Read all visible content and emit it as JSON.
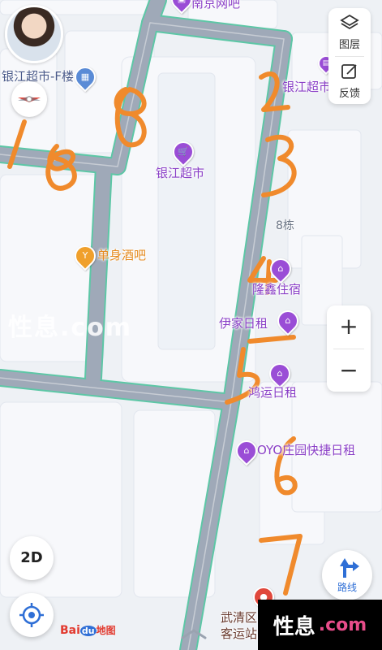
{
  "map": {
    "pois": [
      {
        "name": "南京网吧",
        "kind": "internet-cafe",
        "color": "#9a4dd6"
      },
      {
        "name": "银江超市-F楼",
        "kind": "building",
        "color": "#5a8bd6"
      },
      {
        "name": "银江超市",
        "kind": "supermarket",
        "color": "#9a4dd6"
      },
      {
        "name": "银江超市",
        "kind": "supermarket",
        "color": "#9a4dd6"
      },
      {
        "name": "8栋",
        "kind": "building-number"
      },
      {
        "name": "单身酒吧",
        "kind": "bar",
        "color": "#f0a02c"
      },
      {
        "name": "隆鑫住宿",
        "kind": "hotel",
        "color": "#9a4dd6"
      },
      {
        "name": "伊家日租",
        "kind": "hotel",
        "color": "#9a4dd6"
      },
      {
        "name": "鸿运日租",
        "kind": "hotel",
        "color": "#9a4dd6"
      },
      {
        "name": "OYO庄园快捷日租",
        "kind": "hotel",
        "color": "#9a4dd6"
      },
      {
        "name": "武清区客运站",
        "kind": "bus-station",
        "color": "#e0483c"
      }
    ],
    "handwritten_numbers": [
      "1",
      "8",
      "8",
      "2",
      "3",
      "4",
      "5",
      "6",
      "7"
    ],
    "ink_color": "#f08a2c"
  },
  "controls": {
    "layers_label": "图层",
    "feedback_label": "反馈",
    "zoom_in": "+",
    "zoom_out": "−",
    "mode_2d": "2D",
    "route_label": "路线"
  },
  "branding": {
    "baidu_bai": "Bai",
    "baidu_du": "du",
    "baidu_map": "地图"
  },
  "watermark": {
    "text": "性息",
    "domain": ".com"
  },
  "icons": {
    "layers": "layers-icon",
    "feedback": "feedback-icon",
    "locate": "locate-icon",
    "route": "route-arrow-icon",
    "compass": "compass-icon"
  }
}
